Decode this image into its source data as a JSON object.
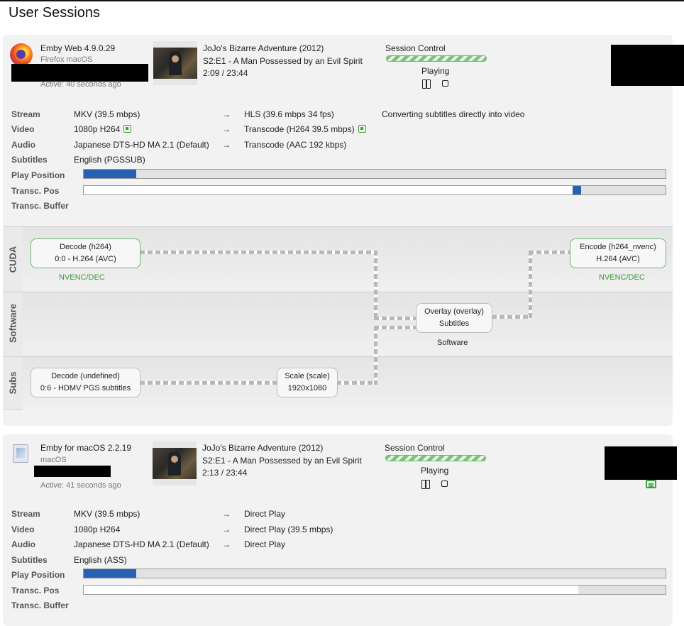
{
  "page": {
    "title": "User Sessions"
  },
  "sessions": [
    {
      "client_name": "Emby Web 4.9.0.29",
      "client_sub": "Firefox macOS",
      "active": "Active: 40 seconds ago",
      "media": {
        "title": "JoJo's Bizarre Adventure (2012)",
        "episode": "S2:E1 - A Man Possessed by an Evil Spirit",
        "time": "2:09 / 23:44"
      },
      "control": {
        "title": "Session Control",
        "state": "Playing"
      },
      "rows": {
        "labels": [
          "Stream",
          "Video",
          "Audio",
          "Subtitles",
          "Play Position",
          "Transc. Pos",
          "Transc. Buffer"
        ],
        "stream": {
          "from": "MKV (39.5 mbps)",
          "to": "HLS (39.6 mbps 34 fps)",
          "note": "Converting subtitles directly into video"
        },
        "video": {
          "from": "1080p H264",
          "to": "Transcode (H264 39.5 mbps)"
        },
        "audio": {
          "from": "Japanese DTS-HD MA 2.1 (Default)",
          "to": "Transcode (AAC 192 kbps)"
        },
        "subtitles": {
          "from": "English (PGSSUB)"
        },
        "arrow": "→"
      },
      "play_position_pct": 9,
      "transc_pos_pct": 84,
      "transc_pos_marker_pct": 1.5,
      "pipeline": {
        "lanes": [
          "CUDA",
          "Software",
          "Subs"
        ],
        "nodes": {
          "decode_cuda": {
            "title": "Decode (h264)",
            "detail": "0:0 - H.264 (AVC)",
            "hw": "NVENC/DEC"
          },
          "encode_cuda": {
            "title": "Encode (h264_nvenc)",
            "detail": "H.264 (AVC)",
            "hw": "NVENC/DEC"
          },
          "overlay": {
            "title": "Overlay (overlay)",
            "detail": "Subtitles",
            "hw": "Software"
          },
          "decode_subs": {
            "title": "Decode (undefined)",
            "detail": "0:6 - HDMV PGS subtitles"
          },
          "scale": {
            "title": "Scale (scale)",
            "detail": "1920x1080"
          }
        }
      }
    },
    {
      "client_name": "Emby for macOS 2.2.19",
      "client_sub": "macOS",
      "active": "Active: 41 seconds ago",
      "media": {
        "title": "JoJo's Bizarre Adventure (2012)",
        "episode": "S2:E1 - A Man Possessed by an Evil Spirit",
        "time": "2:13 / 23:44"
      },
      "control": {
        "title": "Session Control",
        "state": "Playing"
      },
      "rows": {
        "labels": [
          "Stream",
          "Video",
          "Audio",
          "Subtitles",
          "Play Position",
          "Transc. Pos",
          "Transc. Buffer"
        ],
        "stream": {
          "from": "MKV (39.5 mbps)",
          "to": "Direct Play"
        },
        "video": {
          "from": "1080p H264",
          "to": "Direct Play (39.5 mbps)"
        },
        "audio": {
          "from": "Japanese DTS-HD MA 2.1 (Default)",
          "to": "Direct Play"
        },
        "subtitles": {
          "from": "English (ASS)"
        },
        "arrow": "→"
      },
      "play_position_pct": 9,
      "transc_pos_pct": 85
    }
  ],
  "colors": {
    "accent_green": "#3aa53a",
    "bar_blue": "#2860b4"
  }
}
